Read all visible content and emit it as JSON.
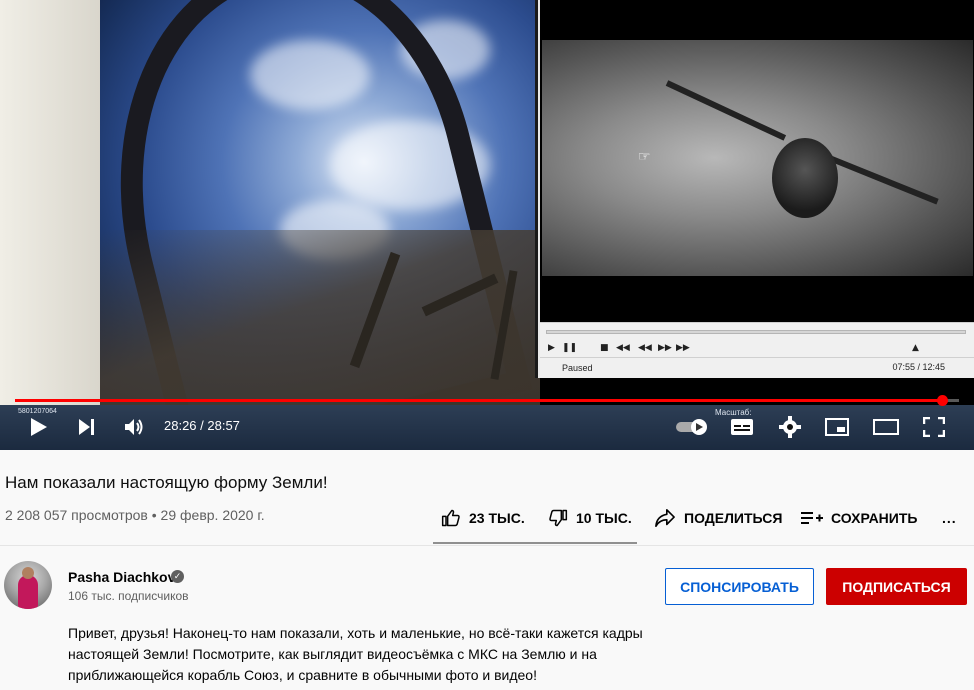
{
  "player": {
    "time": "28:26 / 28:57",
    "progress": 0.982,
    "inset": {
      "status": "Paused",
      "time": "07:55 / 12:45"
    },
    "taskbar": {
      "info": "5801207064",
      "scale": "Масштаб:"
    }
  },
  "video": {
    "title": "Нам показали настоящую форму Земли!",
    "views": "2 208 057 просмотров",
    "date": "29 февр. 2020 г."
  },
  "actions": {
    "likes": "23 ТЫС.",
    "dislikes": "10 ТЫС.",
    "share": "ПОДЕЛИТЬСЯ",
    "save": "СОХРАНИТЬ",
    "more": "..."
  },
  "channel": {
    "name": "Pasha Diachkov",
    "subscribers": "106 тыс. подписчиков",
    "verified_mark": "✓"
  },
  "buttons": {
    "sponsor": "СПОНСИРОВАТЬ",
    "subscribe": "ПОДПИСАТЬСЯ"
  },
  "description": "Привет, друзья! Наконец-то нам показали, хоть и маленькие, но всё-таки кажется кадры настоящей Земли! Посмотрите, как выглядит видеосъёмка с МКС на Землю и на приближающейся корабль Союз, и сравните в обычными фото и видео!",
  "colors": {
    "accent_red": "#ff0000",
    "subscribe_bg": "#cc0000",
    "sponsor_blue": "#065fd4"
  }
}
